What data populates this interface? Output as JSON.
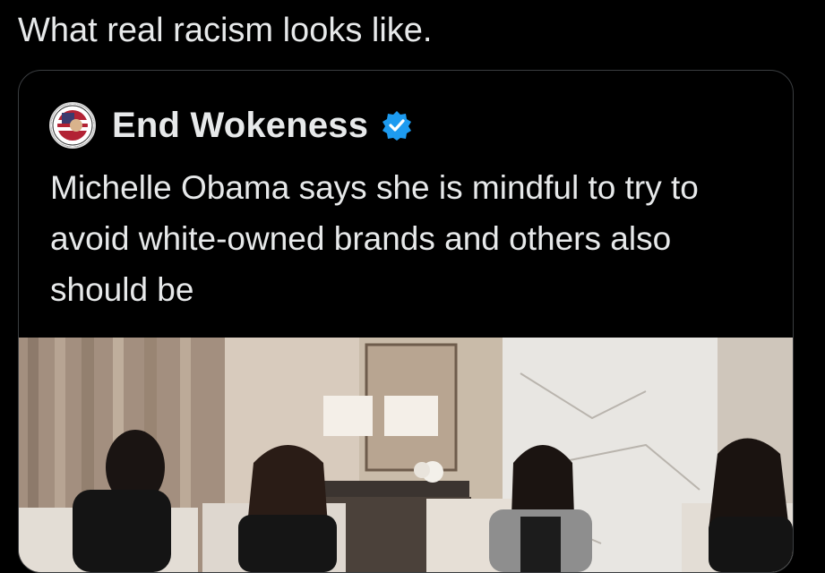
{
  "post": {
    "text": "What real racism looks like."
  },
  "quoted_post": {
    "author_name": "End Wokeness",
    "avatar_icon": "badge-avatar-icon",
    "verified_icon": "verified-badge-icon",
    "verified_color": "#1d9bf0",
    "body": "Michelle Obama says she is mindful to try to avoid white-owned brands and others also should be",
    "media": {
      "type": "video-still",
      "description_icon": "media-image-icon"
    }
  },
  "colors": {
    "background": "#000000",
    "text": "#e7e9ea",
    "card_border": "#3a3d40"
  }
}
